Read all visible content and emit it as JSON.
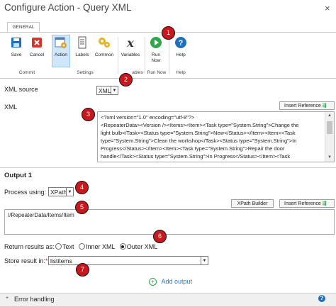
{
  "window": {
    "title": "Configure Action - Query XML",
    "close": "×"
  },
  "tabs": [
    {
      "label": "GENERAL"
    }
  ],
  "ribbon": {
    "buttons": [
      {
        "label": "Save"
      },
      {
        "label": "Cancel"
      },
      {
        "label": "Action"
      },
      {
        "label": "Labels"
      },
      {
        "label": "Common"
      },
      {
        "label": "Variables"
      },
      {
        "label": "Run\nNow"
      },
      {
        "label": "Help"
      }
    ],
    "groups": [
      {
        "label": "Commit"
      },
      {
        "label": "Settings"
      },
      {
        "label": "ables"
      },
      {
        "label": "Run Now"
      },
      {
        "label": "Help"
      }
    ]
  },
  "form": {
    "xml_source_label": "XML source",
    "xml_source_value": "XML",
    "xml_label": "XML",
    "insert_reference": "Insert Reference",
    "xml_lines": [
      "<?xml version=\"1.0\" encoding=\"utf-8\"?>",
      "<RepeaterData><Version /><Items><Item><Task type=\"System.String\">Change the",
      "light bulb</Task><Status type=\"System.String\">New</Status></Item><Item><Task",
      "type=\"System.String\">Clean the workshop</Task><Status type=\"System.String\">In",
      "Progress</Status></Item><Item><Task type=\"System.String\">Repair the door",
      "handle</Task><Status type=\"System.String\">In Progress</Status></Item><Task"
    ],
    "output_heading": "Output 1",
    "process_using_label": "Process using:",
    "process_using_value": "XPath",
    "xpath_builder": "XPath Builder",
    "insert_reference2": "Insert Reference",
    "xpath_value": "//RepeaterData/Items/Item",
    "return_results_label": "Return results as:",
    "return_options": [
      {
        "label": "Text"
      },
      {
        "label": "Inner XML"
      },
      {
        "label": "Outer XML"
      }
    ],
    "return_selected": "Outer XML",
    "store_result_label": "Store result in:",
    "store_required": "*",
    "store_value": "listitems",
    "add_output": "Add output",
    "error_handling": "Error handling"
  },
  "markers": [
    "1",
    "2",
    "3",
    "4",
    "5",
    "6",
    "7"
  ],
  "colors": {
    "accent_blue": "#1f7ac8",
    "marker_red": "#c9171d",
    "run_green": "#2aa84a",
    "cancel_red": "#d9342b"
  }
}
